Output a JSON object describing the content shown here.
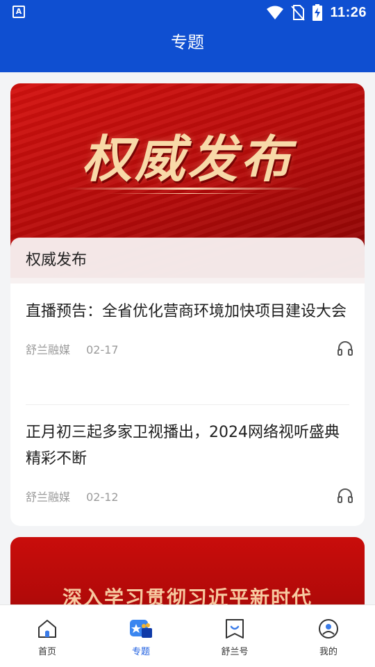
{
  "status": {
    "left_badge": "A",
    "time": "11:26"
  },
  "header": {
    "title": "专题"
  },
  "topics": [
    {
      "banner_text": "权威发布",
      "label": "权威发布",
      "articles": [
        {
          "title": "直播预告：全省优化营商环境加快项目建设大会",
          "source": "舒兰融媒",
          "date": "02-17"
        },
        {
          "title": "正月初三起多家卫视播出，2024网络视听盛典精彩不断",
          "source": "舒兰融媒",
          "date": "02-12"
        }
      ]
    },
    {
      "banner_text": "深入学习贯彻习近平新时代"
    }
  ],
  "bottom_nav": {
    "items": [
      {
        "label": "首页",
        "icon": "home-icon",
        "active": false
      },
      {
        "label": "专题",
        "icon": "topic-icon",
        "active": true
      },
      {
        "label": "舒兰号",
        "icon": "bookmark-icon",
        "active": false
      },
      {
        "label": "我的",
        "icon": "profile-icon",
        "active": false
      }
    ]
  },
  "colors": {
    "brand_blue": "#0f4fd1",
    "active_tab": "#1f5fe0",
    "banner_red": "#c9120f"
  }
}
